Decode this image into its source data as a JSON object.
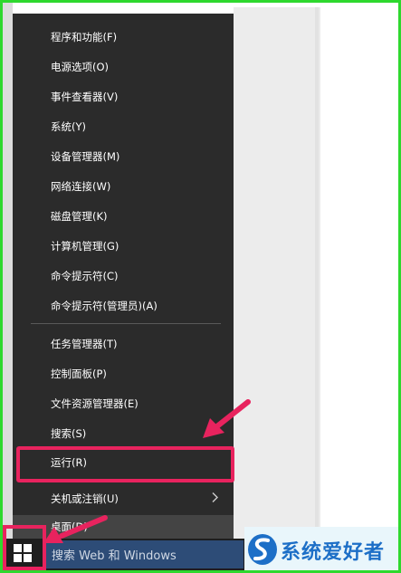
{
  "menu": {
    "items": [
      {
        "label": "程序和功能(F)"
      },
      {
        "label": "电源选项(O)"
      },
      {
        "label": "事件查看器(V)"
      },
      {
        "label": "系统(Y)"
      },
      {
        "label": "设备管理器(M)"
      },
      {
        "label": "网络连接(W)"
      },
      {
        "label": "磁盘管理(K)"
      },
      {
        "label": "计算机管理(G)"
      },
      {
        "label": "命令提示符(C)"
      },
      {
        "label": "命令提示符(管理员)(A)"
      },
      {
        "label": "任务管理器(T)"
      },
      {
        "label": "控制面板(P)"
      },
      {
        "label": "文件资源管理器(E)"
      },
      {
        "label": "搜索(S)"
      },
      {
        "label": "运行(R)"
      },
      {
        "label": "关机或注销(U)"
      },
      {
        "label": "桌面(D)"
      }
    ],
    "submenu_icon": "chevron-right-icon"
  },
  "taskbar": {
    "start_icon": "windows-start-icon",
    "search_placeholder": "搜索 Web 和 Windows"
  },
  "annotations": {
    "highlight_color": "#e8235e",
    "arrow_color": "#e8235e"
  },
  "watermark": {
    "logo_icon": "site-logo-icon",
    "text": "系统爱好者"
  },
  "colors": {
    "menu_bg": "#2b2b2b",
    "menu_text": "#ffffff",
    "search_bg": "#2d4c77",
    "frame": "#2ed82e"
  }
}
